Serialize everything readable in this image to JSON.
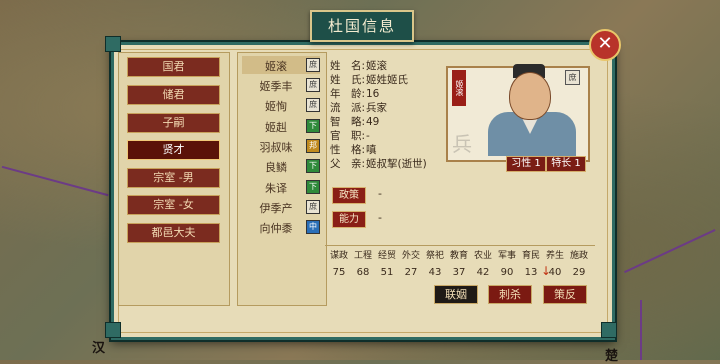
{
  "map": {
    "labels": [
      "汉",
      "楚"
    ]
  },
  "window": {
    "title": "杜国信息",
    "close_icon": "close-x-icon"
  },
  "categories": [
    {
      "label": "国君",
      "active": false
    },
    {
      "label": "储君",
      "active": false
    },
    {
      "label": "子嗣",
      "active": false
    },
    {
      "label": "贤才",
      "active": true
    },
    {
      "label": "宗室 -男",
      "active": false
    },
    {
      "label": "宗室 -女",
      "active": false
    },
    {
      "label": "都邑大夫",
      "active": false
    }
  ],
  "people": [
    {
      "name": "姬滚",
      "tag": "庶",
      "selected": true
    },
    {
      "name": "姬季丰",
      "tag": "庶",
      "selected": false
    },
    {
      "name": "姬恂",
      "tag": "庶",
      "selected": false
    },
    {
      "name": "姬赳",
      "tag": "下",
      "selected": false
    },
    {
      "name": "羽叔味",
      "tag": "邦",
      "selected": false
    },
    {
      "name": "良鳞",
      "tag": "下",
      "selected": false
    },
    {
      "name": "朱译",
      "tag": "下",
      "selected": false
    },
    {
      "name": "伊季产",
      "tag": "庶",
      "selected": false
    },
    {
      "name": "向仲黍",
      "tag": "中",
      "selected": false
    }
  ],
  "profile": {
    "fields": [
      {
        "key": "姓　名:",
        "value": "姬滚"
      },
      {
        "key": "姓　氏:",
        "value": "姬姓姬氏"
      },
      {
        "key": "年　龄:",
        "value": "16"
      },
      {
        "key": "流　派:",
        "value": "兵家"
      },
      {
        "key": "智　略:",
        "value": "49"
      },
      {
        "key": "官　职:",
        "value": "-"
      },
      {
        "key": "性　格:",
        "value": "嗔"
      },
      {
        "key": "父　亲:",
        "value": "姬叔挈(逝世)"
      }
    ],
    "portrait_badge": "姬滚",
    "portrait_tag": "庶",
    "portrait_watermark": "兵",
    "skills": [
      "习性 1",
      "特长 1"
    ],
    "policy_label": "政策",
    "policy_value": "-",
    "ability_label": "能力",
    "ability_value": "-"
  },
  "stats": {
    "headers": [
      "谋政",
      "工程",
      "经贸",
      "外交",
      "祭祀",
      "教育",
      "农业",
      "军事",
      "育民",
      "养生",
      "施政"
    ],
    "values": [
      "75",
      "68",
      "51",
      "27",
      "43",
      "37",
      "42",
      "90",
      "13",
      "40",
      "29"
    ]
  },
  "actions": [
    {
      "label": "联姻",
      "style": "dark"
    },
    {
      "label": "刺杀",
      "style": "red"
    },
    {
      "label": "策反",
      "style": "red"
    }
  ],
  "colors": {
    "accent_red": "#7b1a12",
    "frame_teal": "#2f6b63",
    "panel": "#e7dcb8"
  }
}
